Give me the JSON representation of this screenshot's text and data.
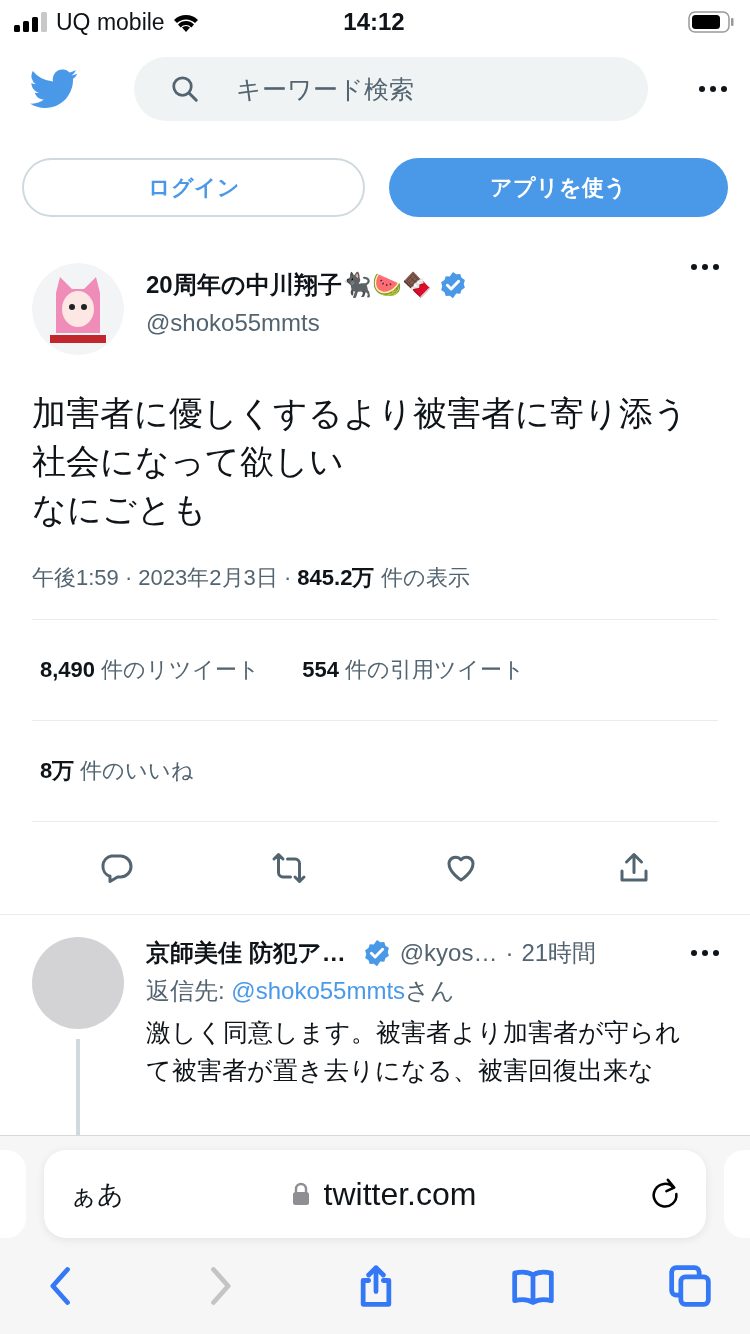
{
  "status_bar": {
    "carrier": "UQ mobile",
    "time": "14:12"
  },
  "header": {
    "search_placeholder": "キーワード検索"
  },
  "auth_buttons": [
    {
      "label": "ログイン",
      "kind": "outline"
    },
    {
      "label": "アプリを使う",
      "kind": "filled"
    }
  ],
  "tweet": {
    "name": "20周年の中川翔子🐈‍⬛🍉🍫",
    "verified": true,
    "handle": "@shoko55mmts",
    "text": [
      "加害者に優しくするより被害者に寄り添う社会になって欲しい",
      "なにごとも"
    ],
    "meta": "午後1:59 · 2023年2月3日 · **845.2万** 件の表示",
    "stats": [
      "**8,490** 件のリツイート",
      "**554** 件の引用ツイート"
    ],
    "likes": "**8万** 件のいいね"
  },
  "reply": {
    "name": "京師美佳 防犯ア…",
    "verified": true,
    "handle": "@kyos…",
    "separator": "·",
    "time": "21時間",
    "reply_to_label": "返信先:",
    "reply_to_handle": "@shoko55mmts",
    "reply_to_suffix": "さん",
    "text": "激しく同意します。被害者より加害者が守られて被害者が置き去りになる、被害回復出来な"
  },
  "browser": {
    "text_size": "ぁあ",
    "url": "twitter.com",
    "back_enabled": true,
    "forward_enabled": false
  }
}
